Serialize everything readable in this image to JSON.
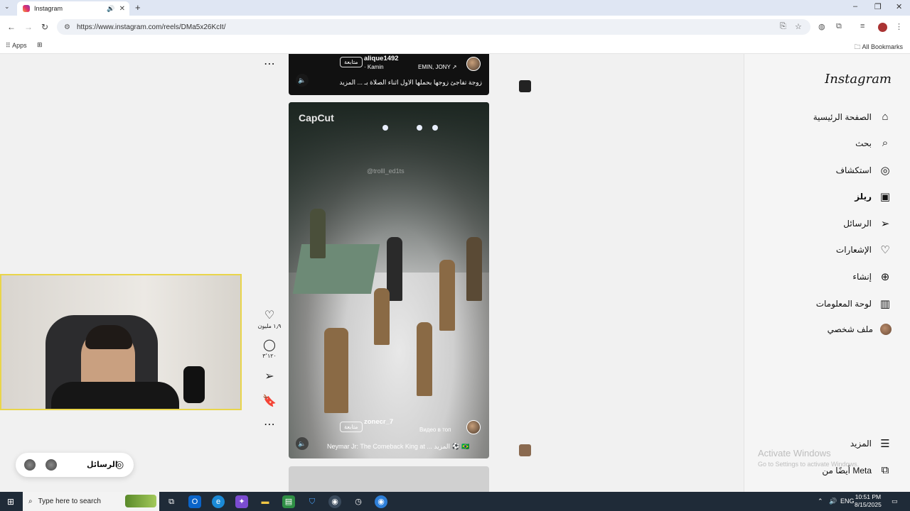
{
  "browser": {
    "tab_title": "Instagram",
    "new_tab": "+",
    "url": "https://www.instagram.com/reels/DMa5x26KcIt/",
    "bookmarks": {
      "apps_label": "Apps",
      "all_bookmarks_label": "All Bookmarks"
    }
  },
  "sidebar": {
    "logo": "Instagram",
    "items": [
      {
        "label": "الصفحة الرئيسية",
        "icon": "home-icon"
      },
      {
        "label": "بحث",
        "icon": "search-icon"
      },
      {
        "label": "استكشاف",
        "icon": "explore-icon"
      },
      {
        "label": "ريلز",
        "icon": "reels-icon",
        "active": true
      },
      {
        "label": "الرسائل",
        "icon": "messages-icon"
      },
      {
        "label": "الإشعارات",
        "icon": "heart-icon"
      },
      {
        "label": "إنشاء",
        "icon": "create-icon"
      },
      {
        "label": "لوحة المعلومات",
        "icon": "dashboard-icon"
      },
      {
        "label": "ملف شخصي",
        "icon": "profile-avatar"
      }
    ],
    "more_label": "المزيد",
    "meta_label": "أيضًا من Meta"
  },
  "reel_top": {
    "username": "alique1492",
    "follow_label": "متابعة",
    "subtitle": "· Kamin",
    "audio": "EMIN, JONY ↗",
    "caption": "زوجة تفاجئ زوجها بحملها الاول اثناء الصلاة بـ ... المزيد"
  },
  "reel_main": {
    "watermark_app": "CapCut",
    "watermark_handle": "@trolll_ed1ts",
    "username": "zonecr_7",
    "follow_label": "متابعة",
    "audio": "Видео в топ",
    "caption": "Neymar Jr: The Comeback King at ... المزيد ⚽ 🇧🇷"
  },
  "actions": {
    "likes": "١٫٩ مليون",
    "comments": "٣٬١٢٠"
  },
  "messages_pill": {
    "label": "الرسائل"
  },
  "watermark_os": {
    "line1": "Activate Windows",
    "line2": "Go to Settings to activate Windows."
  },
  "taskbar": {
    "search_placeholder": "Type here to search",
    "lang": "ENG",
    "time": "10:51 PM",
    "date": "8/15/2025"
  },
  "colors": {
    "accent": "#e1306c",
    "taskbar": "#1f2b38",
    "highlight": "#e9d54a"
  }
}
